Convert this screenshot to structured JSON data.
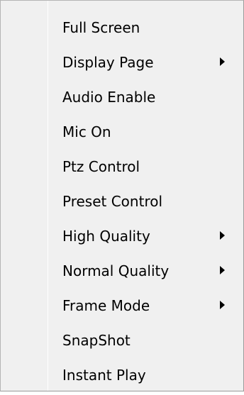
{
  "context_menu": {
    "items": [
      {
        "label": "Full Screen",
        "submenu": false
      },
      {
        "label": "Display Page",
        "submenu": true
      },
      {
        "label": "Audio Enable",
        "submenu": false
      },
      {
        "label": "Mic On",
        "submenu": false
      },
      {
        "label": "Ptz Control",
        "submenu": false
      },
      {
        "label": "Preset Control",
        "submenu": false
      },
      {
        "label": "High Quality",
        "submenu": true
      },
      {
        "label": "Normal Quality",
        "submenu": true
      },
      {
        "label": "Frame Mode",
        "submenu": true
      },
      {
        "label": "SnapShot",
        "submenu": false
      },
      {
        "label": "Instant Play",
        "submenu": false
      }
    ]
  },
  "icons": {
    "submenu_arrow": "chevron-right-icon"
  },
  "colors": {
    "menu_background": "#f0f0f0",
    "menu_border": "#b4b4b4",
    "text": "#000000"
  }
}
